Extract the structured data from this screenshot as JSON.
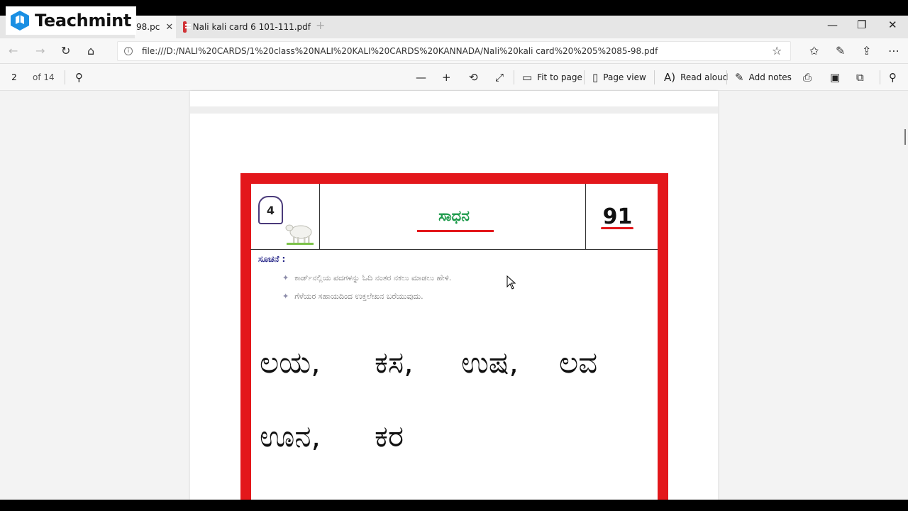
{
  "app": {
    "name": "Microsoft Edge PDF viewer"
  },
  "logo": {
    "text": "Teachmint"
  },
  "tabs": [
    {
      "label": "98.pc",
      "active": true
    },
    {
      "label": "Nali kali card 6 101-111.pdf",
      "active": false
    }
  ],
  "address_bar": {
    "url": "file:///D:/NALI%20CARDS/1%20class%20NALI%20KALI%20CARDS%20KANNADA/Nali%20kali card%20%205%2085-98.pdf"
  },
  "pdf_toolbar": {
    "current_page": "2",
    "page_count": "of 14",
    "fit_to_page": "Fit to page",
    "page_view": "Page view",
    "read_aloud": "Read aloud",
    "add_notes": "Add notes"
  },
  "card": {
    "level": "4",
    "title": "ಸಾಧನ",
    "number": "91",
    "hint_label": "ಸೂಚನೆ :",
    "hints": [
      "ಕಾರ್ಡ್‌ನಲ್ಲಿಯ ಪದಗಳನ್ನು ಓದಿ ನಂತರ ನಕಲು ಮಾಡಲು ಹೇಳಿ.",
      "ಗೆಳೆಯರ ಸಹಾಯದಿಂದ ಉಕ್ತಲೇಖನ ಬರೆಯುವುದು."
    ],
    "words_row1": [
      "ಲಯ,",
      "ಕಸ,",
      "ಉಷ,",
      "ಲವ"
    ],
    "words_row2": [
      "ಊನ,",
      "ಕರ"
    ]
  },
  "colors": {
    "card_border": "#e3171b",
    "title_green": "#1c9a4a",
    "pdf_icon": "#d13438"
  }
}
